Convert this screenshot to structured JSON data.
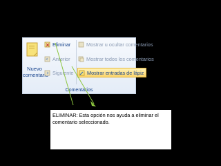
{
  "ribbon": {
    "new_comment_label": "Nuevo comentario",
    "delete_label": "Eliminar",
    "previous_label": "Anterior",
    "next_label": "Siguiente",
    "show_hide_label": "Mostrar u ocultar comentarios",
    "show_all_label": "Mostrar todos los comentarios",
    "show_ink_label": "Mostrar entradas de lápiz",
    "group_label": "Comentarios",
    "accent_color": "#15428b",
    "highlight_color": "#fcd46a"
  },
  "annotation": {
    "text": "ELIMINAR: Esta opción nos ayuda a eliminar el comentario seleccionado.",
    "arrow_color": "#8dc63f"
  },
  "icons": [
    "new-comment-icon",
    "delete-icon",
    "previous-icon",
    "next-icon",
    "show-hide-icon",
    "show-all-icon",
    "ink-icon"
  ]
}
